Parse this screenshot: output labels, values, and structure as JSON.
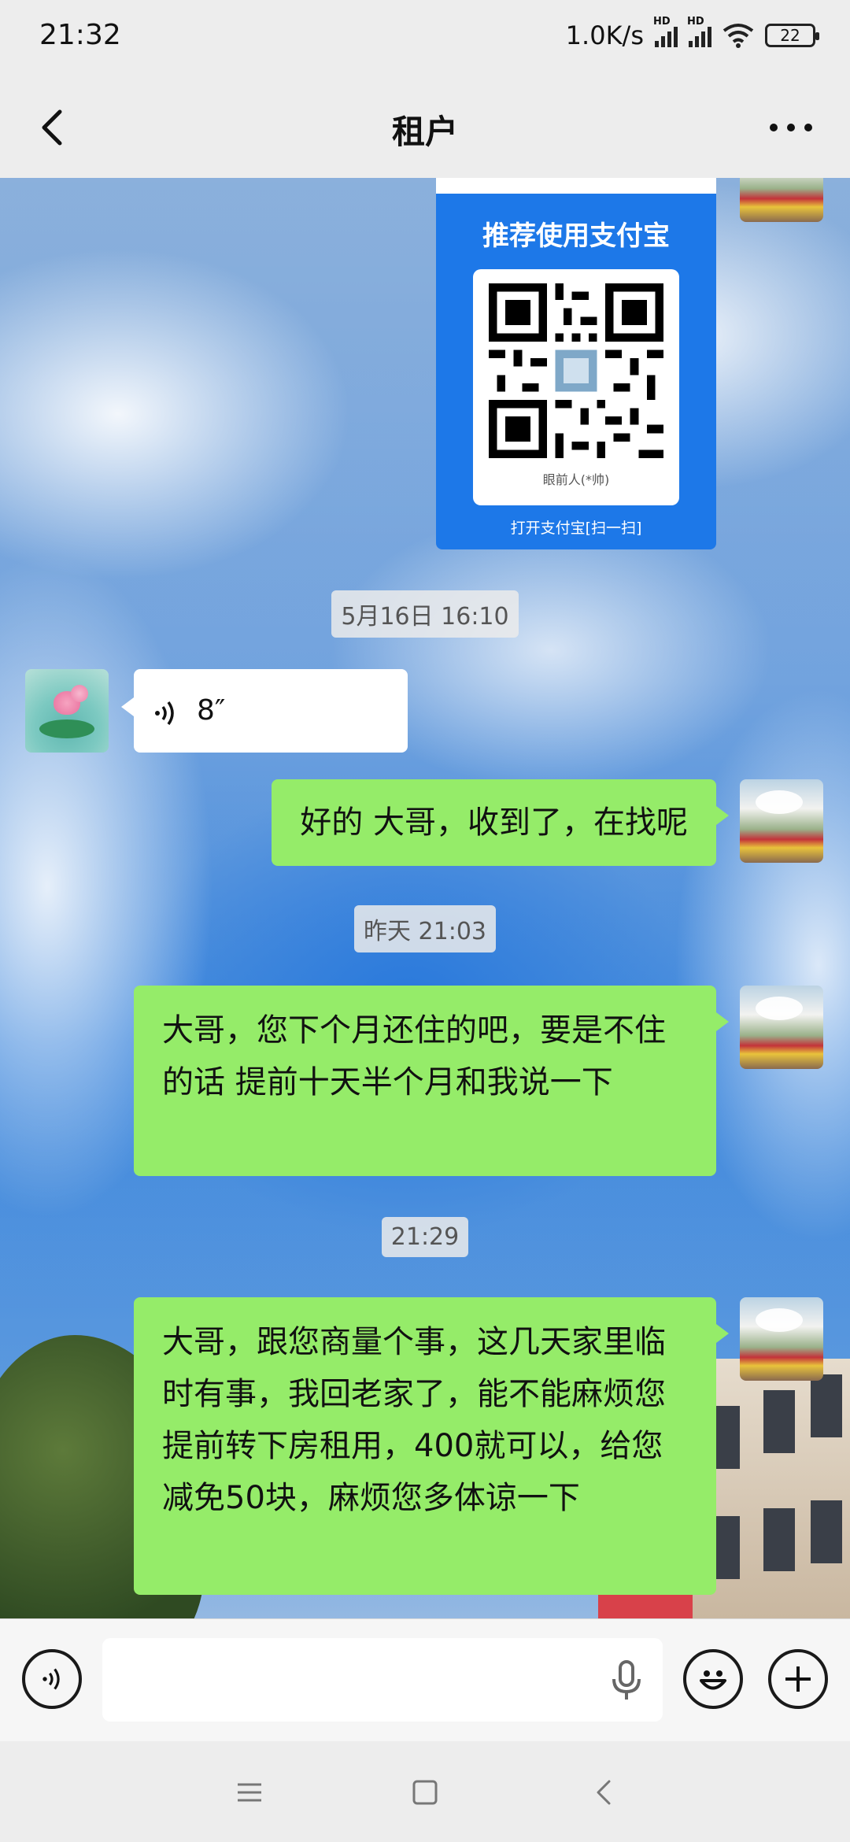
{
  "status_bar": {
    "time": "21:32",
    "network_speed": "1.0K/s",
    "signal_1_label": "HD",
    "signal_2_label": "HD",
    "battery": "22"
  },
  "nav": {
    "title": "租户",
    "back_icon": "chevron-left-icon",
    "more_icon": "more-dots-icon"
  },
  "messages": {
    "qr_card": {
      "title": "推荐使用支付宝",
      "name": "眼前人(*帅)",
      "footer": "打开支付宝[扫一扫]"
    },
    "ts1": "5月16日 16:10",
    "voice": {
      "duration": "8″"
    },
    "msg1": "好的 大哥，收到了，在找呢",
    "ts2": "昨天 21:03",
    "msg2": "大哥，您下个月还住的吧，要是不住的话 提前十天半个月和我说一下",
    "ts3": "21:29",
    "msg3": "大哥，跟您商量个事，这几天家里临时有事，我回老家了，能不能麻烦您提前转下房租用，400就可以，给您减免50块，麻烦您多体谅一下"
  },
  "input": {
    "value": "",
    "placeholder": "",
    "voice_toggle_icon": "voice-icon",
    "mic_icon": "microphone-icon",
    "emoji_icon": "emoji-icon",
    "plus_icon": "plus-icon"
  },
  "system_nav": {
    "menu_icon": "menu-icon",
    "home_icon": "home-square-icon",
    "back_icon": "back-triangle-icon"
  },
  "colors": {
    "my_bubble": "#95ec69",
    "peer_bubble": "#ffffff",
    "alipay_blue": "#1d78e8",
    "bar_bg": "#ededed"
  }
}
